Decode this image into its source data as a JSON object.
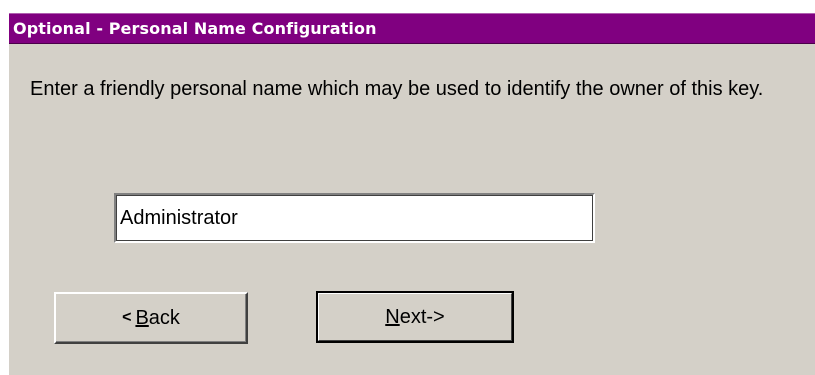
{
  "dialog": {
    "title": "Optional - Personal Name Configuration",
    "instruction": "Enter a friendly personal name which may be used to identify the owner of this key."
  },
  "name_field": {
    "value": "Administrator"
  },
  "buttons": {
    "back_prefix": "<",
    "back_label": "Back",
    "next_label": "Next->"
  },
  "colors": {
    "title_bar": "#800080",
    "title_text": "#ffffff",
    "face": "#d4d0c8"
  }
}
